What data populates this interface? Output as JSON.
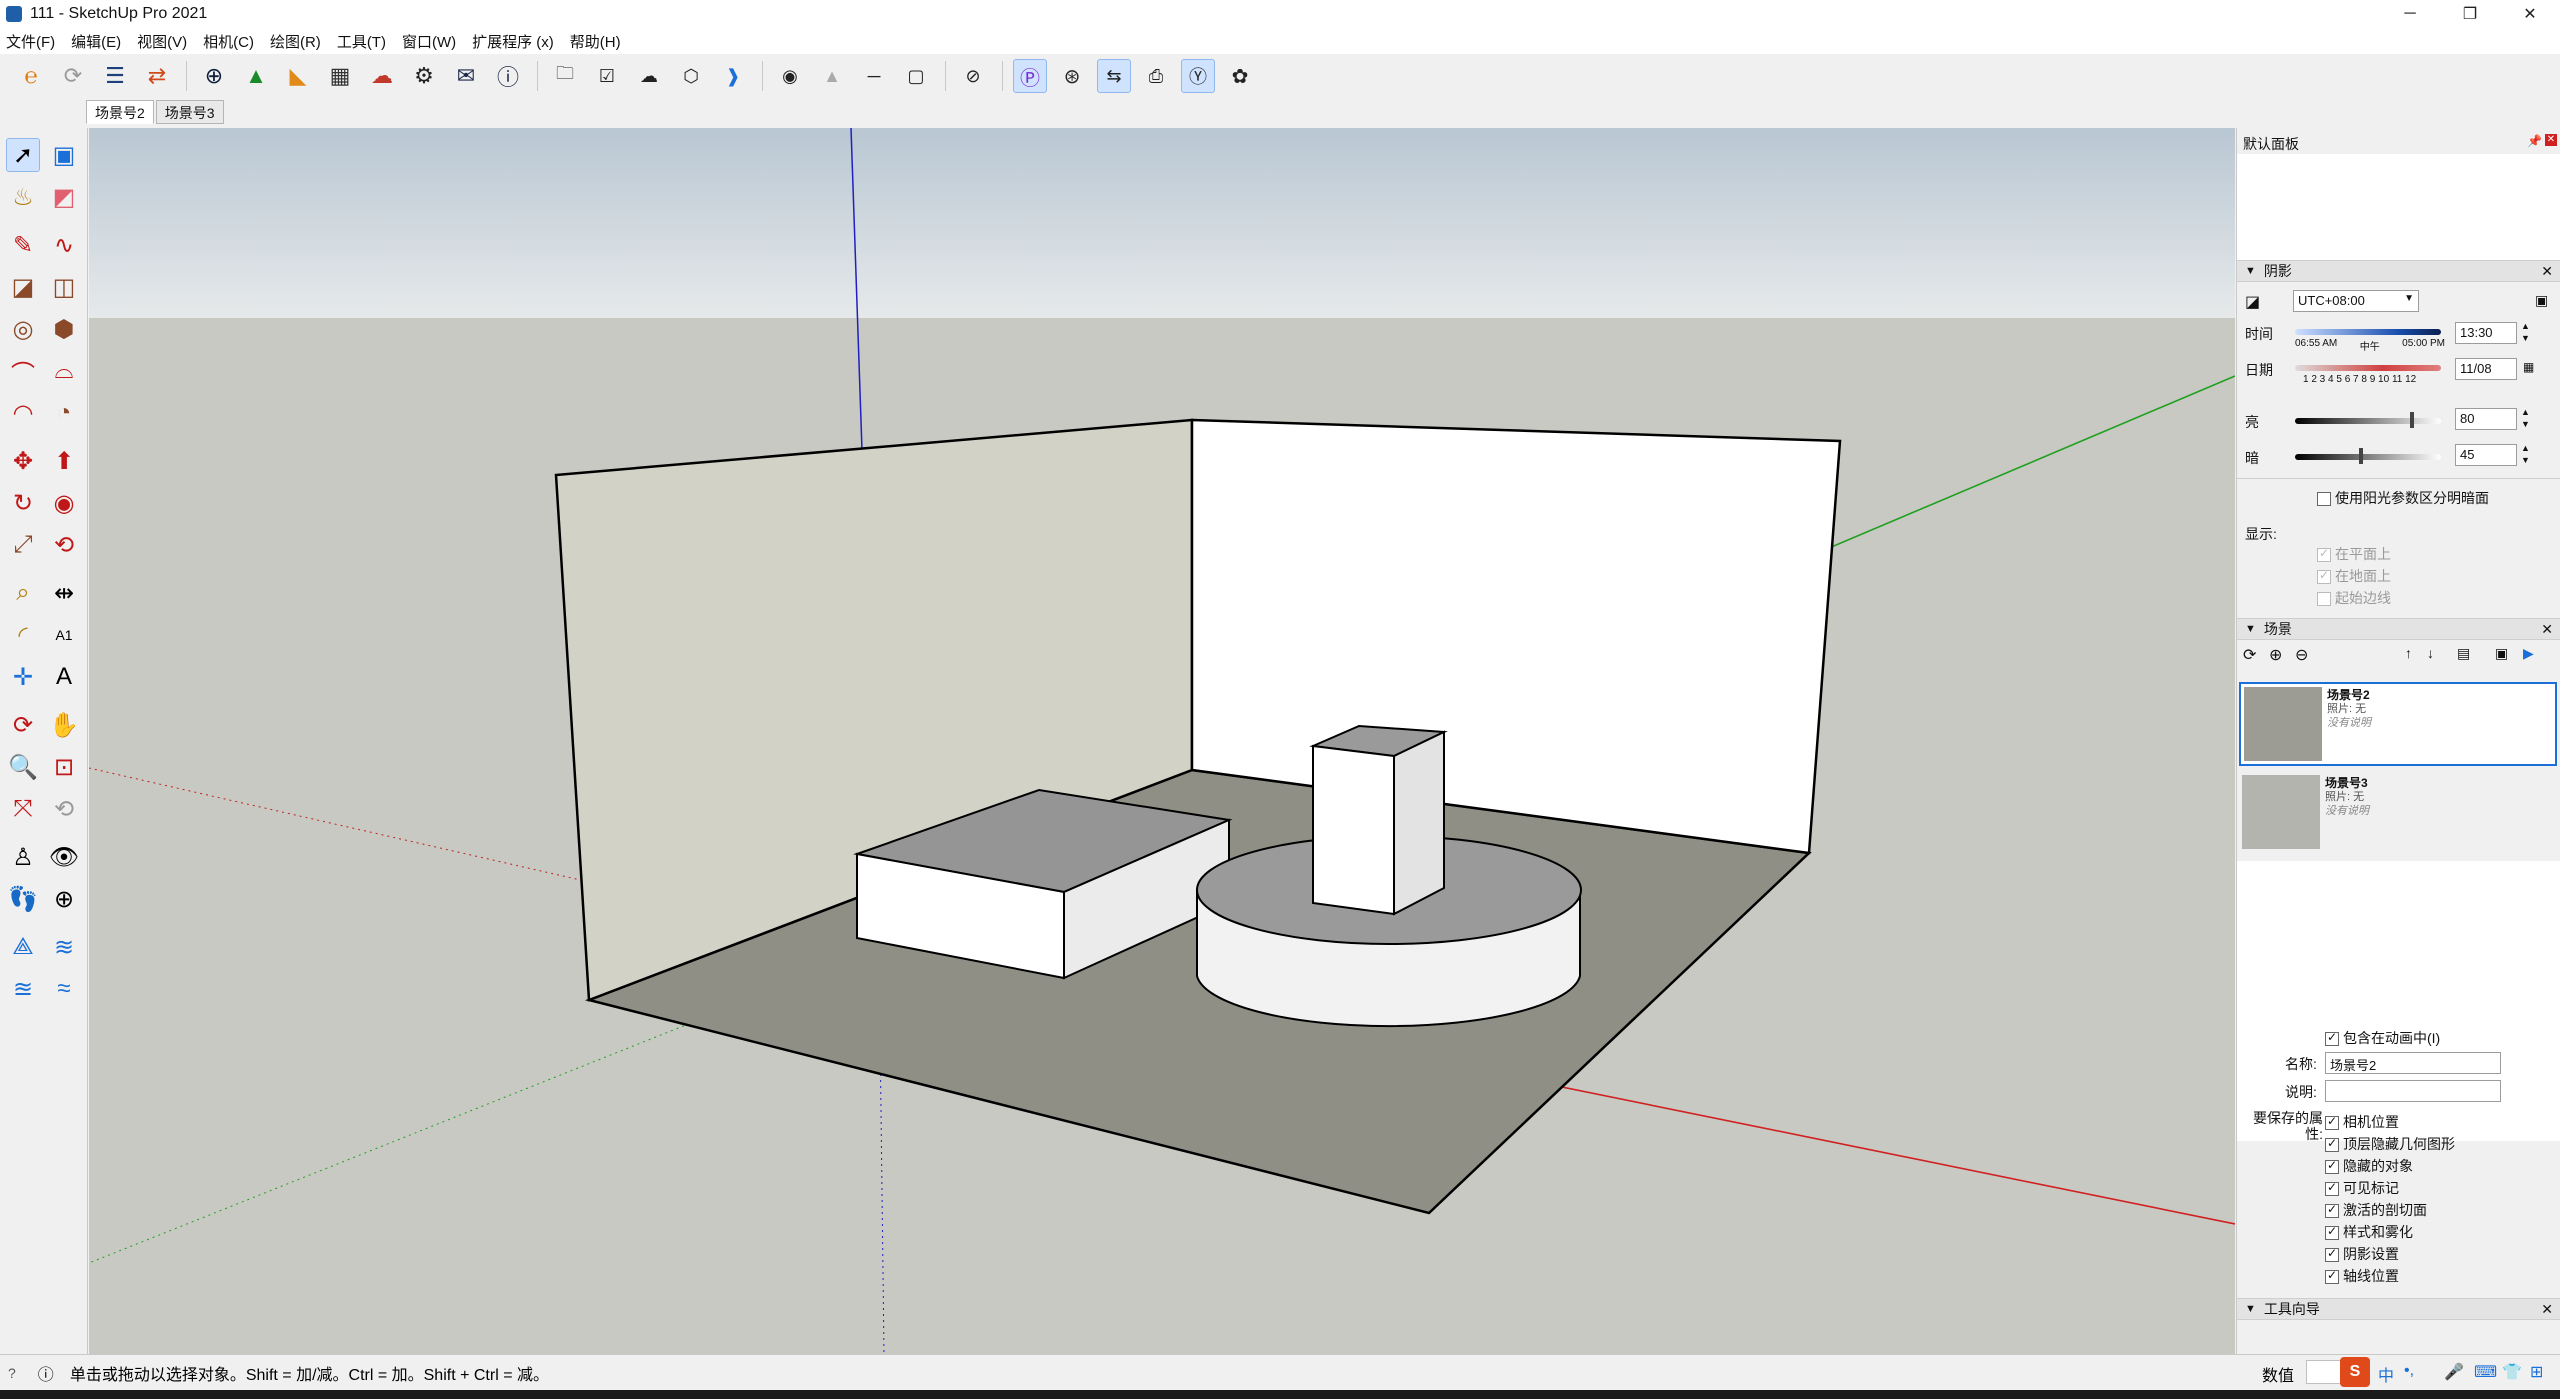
{
  "window": {
    "title": "111 - SketchUp Pro 2021"
  },
  "menu": [
    "文件(F)",
    "编辑(E)",
    "视图(V)",
    "相机(C)",
    "绘图(R)",
    "工具(T)",
    "窗口(W)",
    "扩展程序 (x)",
    "帮助(H)"
  ],
  "scene_tabs": [
    "场景号2",
    "场景号3"
  ],
  "right_panel": {
    "tray_title": "默认面板",
    "shadows": {
      "title": "阴影",
      "timezone": "UTC+08:00",
      "time_label": "时间",
      "time_ticks": [
        "06:55 AM",
        "中午",
        "05:00 PM"
      ],
      "time_value": "13:30",
      "date_label": "日期",
      "date_ticks": "1 2 3 4 5 6 7 8 9 10 11 12",
      "date_value": "11/08",
      "light_label": "亮",
      "light_value": "80",
      "light_level": 0.8,
      "dark_label": "暗",
      "dark_value": "45",
      "dark_level": 0.45,
      "use_sun_label": "使用阳光参数区分明暗面",
      "display_label": "显示:",
      "on_faces": "在平面上",
      "on_ground": "在地面上",
      "from_edges": "起始边线"
    },
    "scenes": {
      "title": "场景",
      "items": [
        {
          "name": "场景号2",
          "photo": "照片: 无",
          "desc": "没有说明"
        },
        {
          "name": "场景号3",
          "photo": "照片: 无",
          "desc": "没有说明"
        }
      ],
      "include_anim": "包含在动画中(I)",
      "name_label": "名称:",
      "name_value": "场景号2",
      "desc_label": "说明:",
      "props_label": "要保存的属性:",
      "props": [
        "相机位置",
        "顶层隐藏几何图形",
        "隐藏的对象",
        "可见标记",
        "激活的剖切面",
        "样式和雾化",
        "阴影设置",
        "轴线位置"
      ]
    },
    "instructor": {
      "title": "工具向导"
    }
  },
  "status": {
    "hint": "单击或拖动以选择对象。Shift = 加/减。Ctrl = 加。Shift + Ctrl = 减。",
    "measure_label": "数值"
  },
  "colors": {
    "sky": "#dfe3e6",
    "ground": "#c9c9c3",
    "floor": "#8f8f86",
    "wall_left": "#cfcfc3",
    "accent_blue": "#1a6fd8"
  }
}
